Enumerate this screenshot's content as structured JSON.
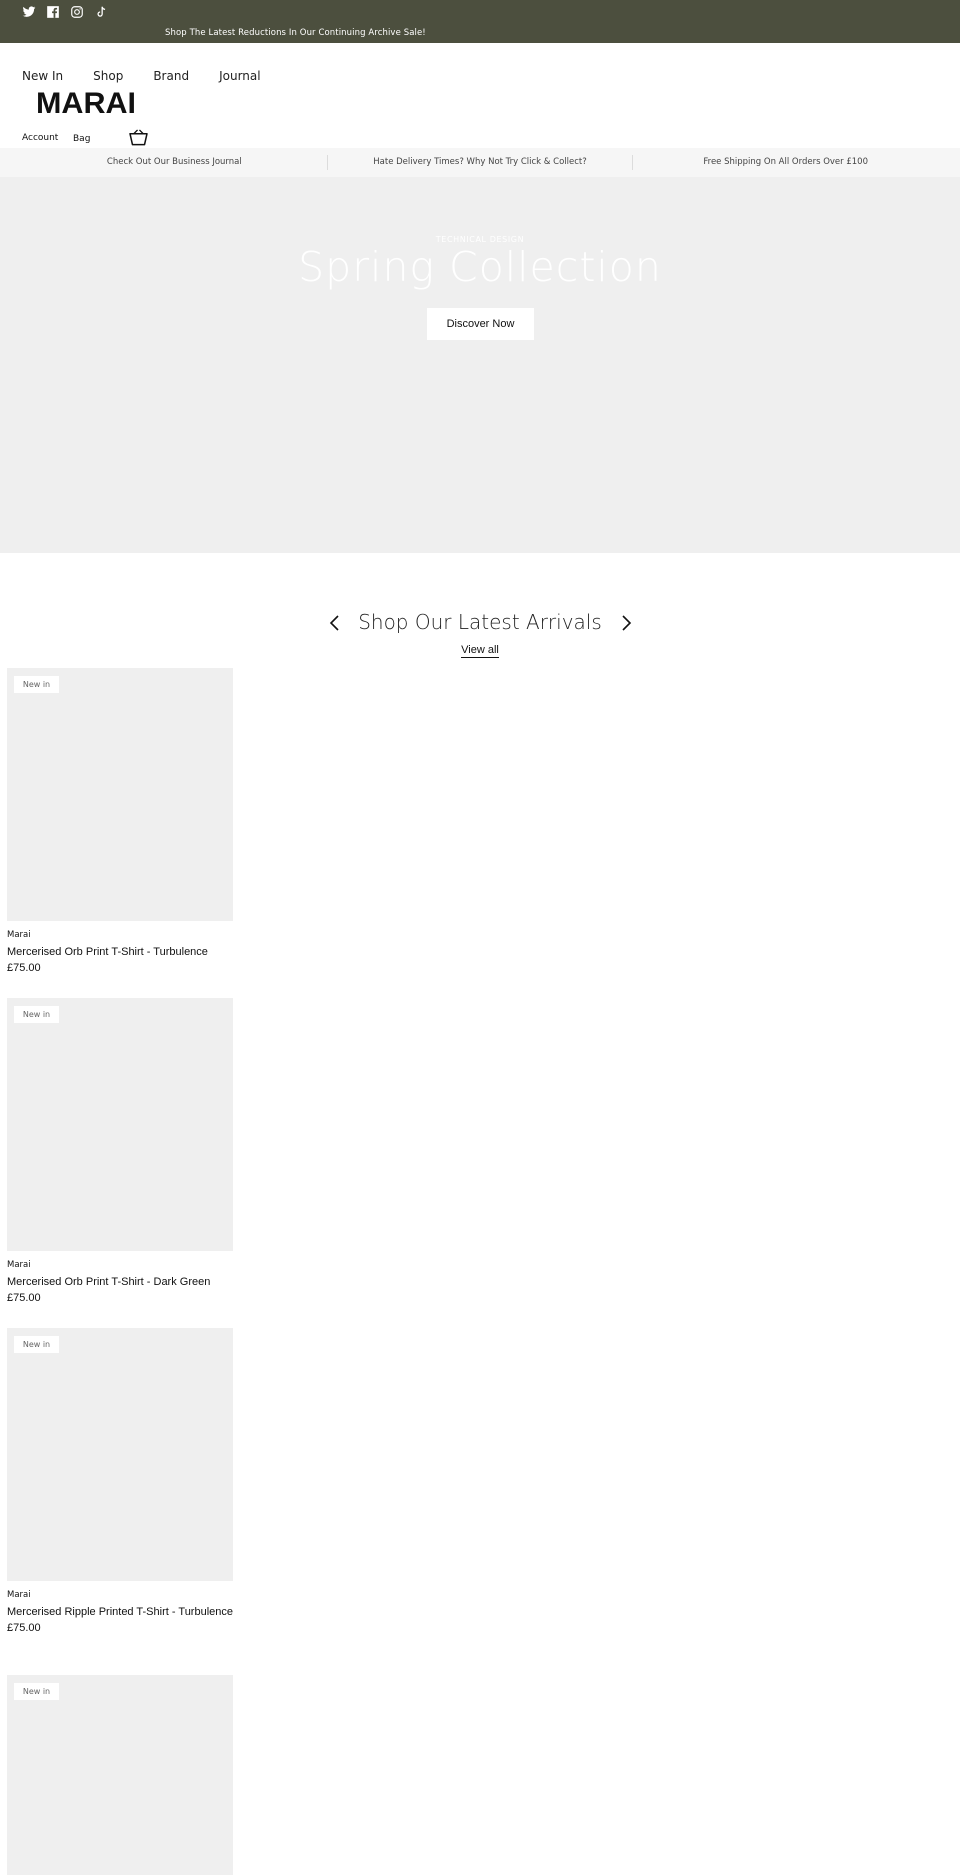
{
  "topbar": {
    "social": [
      "twitter-icon",
      "facebook-icon",
      "instagram-icon",
      "tiktok-icon"
    ],
    "announcement": "Shop The Latest Reductions In Our Continuing Archive Sale!",
    "bg_color": "#4c4f3e"
  },
  "header": {
    "nav": [
      "New In",
      "Shop",
      "Brand",
      "Journal"
    ],
    "logo": "MARAI",
    "account": "Account",
    "bag": "Bag"
  },
  "usp": [
    "Check Out Our Business Journal",
    "Hate Delivery Times? Why Not Try Click & Collect?",
    "Free Shipping On All Orders Over £100"
  ],
  "hero": {
    "kicker": "TECHNICAL DESIGN",
    "title": "Spring Collection",
    "button": "Discover Now"
  },
  "arrivals": {
    "title": "Shop Our Latest Arrivals",
    "view_all": "View all",
    "products": [
      {
        "badge": "New in",
        "brand": "Marai",
        "name": "Mercerised Orb Print T-Shirt - Turbulence",
        "price": "£75.00"
      },
      {
        "badge": "New in",
        "brand": "Marai",
        "name": "Mercerised Orb Print T-Shirt - Dark Green",
        "price": "£75.00"
      },
      {
        "badge": "New in",
        "brand": "Marai",
        "name": "Mercerised Ripple Printed T-Shirt - Turbulence",
        "price": "£75.00"
      },
      {
        "badge": "New in"
      }
    ]
  }
}
